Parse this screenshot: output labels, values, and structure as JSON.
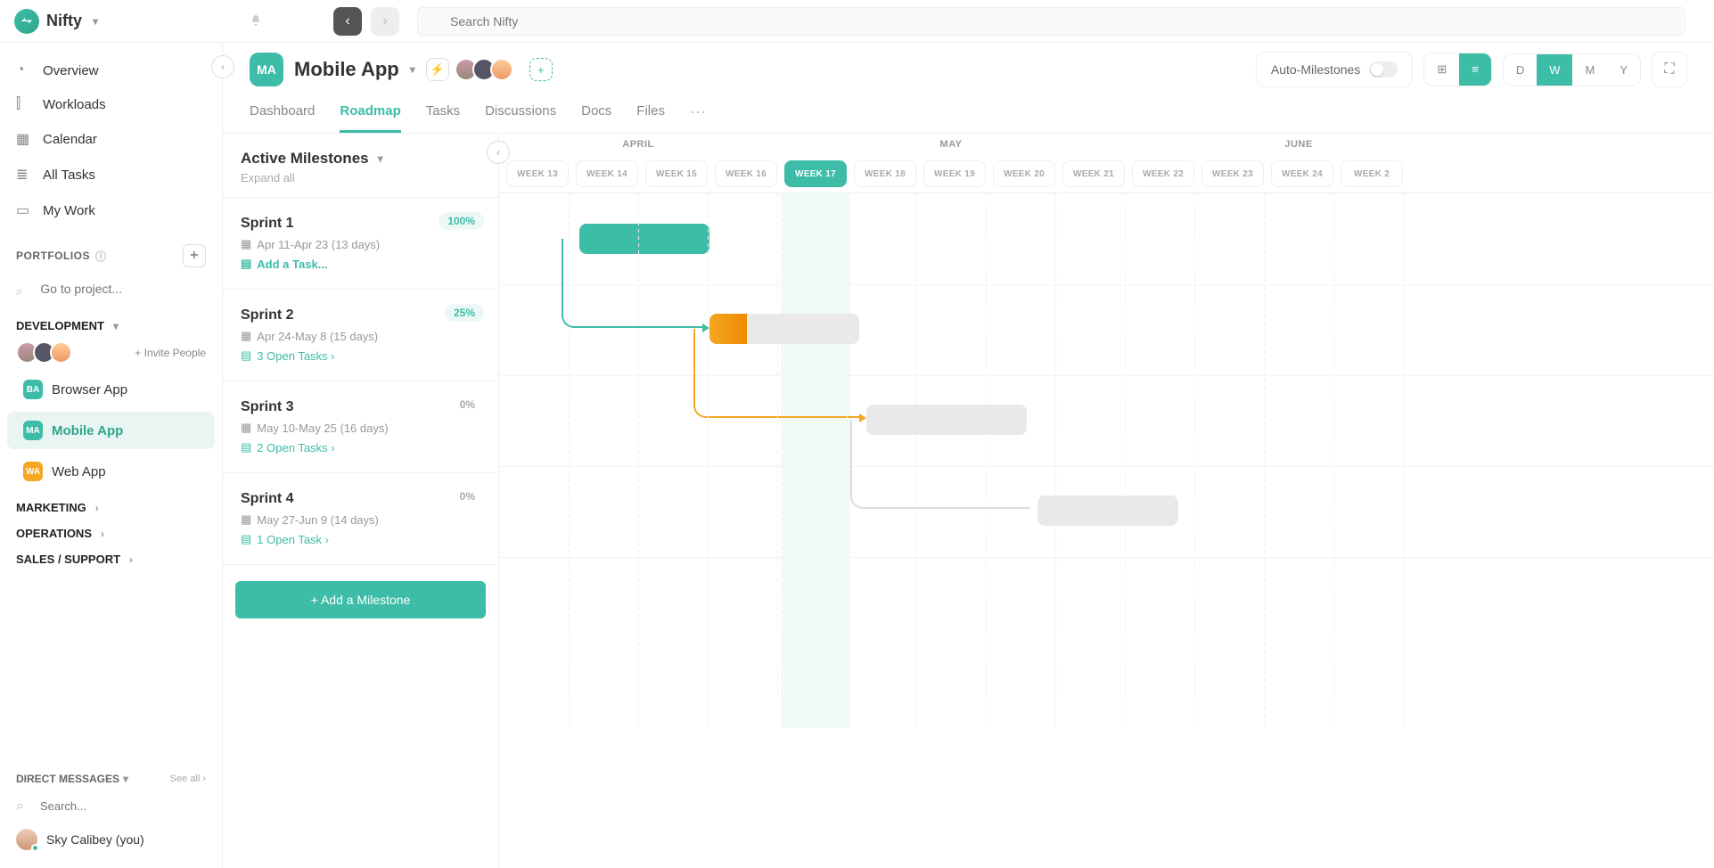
{
  "brand": "Nifty",
  "search_placeholder": "Search Nifty",
  "nav": {
    "overview": "Overview",
    "workloads": "Workloads",
    "calendar": "Calendar",
    "all_tasks": "All Tasks",
    "my_work": "My Work"
  },
  "portfolios": {
    "title": "PORTFOLIOS",
    "goto_placeholder": "Go to project...",
    "groups": {
      "development": "DEVELOPMENT",
      "marketing": "MARKETING",
      "operations": "OPERATIONS",
      "sales": "SALES / SUPPORT"
    },
    "invite": "+ Invite People",
    "projects": {
      "browser": "Browser App",
      "mobile": "Mobile App",
      "web": "Web App",
      "browser_badge": "BA",
      "mobile_badge": "MA",
      "web_badge": "WA"
    }
  },
  "dm": {
    "title": "DIRECT MESSAGES",
    "see_all": "See all",
    "search_placeholder": "Search...",
    "user1": "Sky Calibey (you)"
  },
  "project": {
    "badge": "MA",
    "title": "Mobile App",
    "auto_ms": "Auto-Milestones",
    "zoom": {
      "d": "D",
      "w": "W",
      "m": "M",
      "y": "Y"
    }
  },
  "tabs": {
    "dashboard": "Dashboard",
    "roadmap": "Roadmap",
    "tasks": "Tasks",
    "discussions": "Discussions",
    "docs": "Docs",
    "files": "Files"
  },
  "roadmap": {
    "title": "Active Milestones",
    "expand_all": "Expand all",
    "add_milestone": "+ Add a Milestone"
  },
  "milestones": [
    {
      "name": "Sprint 1",
      "dates": "Apr 11-Apr 23 (13 days)",
      "tasks": "Add a Task...",
      "pct": "100%",
      "pct_zero": false,
      "add_mode": true
    },
    {
      "name": "Sprint 2",
      "dates": "Apr 24-May 8 (15 days)",
      "tasks": "3 Open Tasks",
      "pct": "25%",
      "pct_zero": false,
      "add_mode": false
    },
    {
      "name": "Sprint 3",
      "dates": "May 10-May 25 (16 days)",
      "tasks": "2 Open Tasks",
      "pct": "0%",
      "pct_zero": true,
      "add_mode": false
    },
    {
      "name": "Sprint 4",
      "dates": "May 27-Jun 9 (14 days)",
      "tasks": "1 Open Task",
      "pct": "0%",
      "pct_zero": true,
      "add_mode": false
    }
  ],
  "timeline": {
    "months": {
      "april": "APRIL",
      "may": "MAY",
      "june": "JUNE"
    },
    "weeks": [
      "WEEK 13",
      "WEEK 14",
      "WEEK 15",
      "WEEK 16",
      "WEEK 17",
      "WEEK 18",
      "WEEK 19",
      "WEEK 20",
      "WEEK 21",
      "WEEK 22",
      "WEEK 23",
      "WEEK 24",
      "WEEK 2"
    ],
    "current_week_index": 4
  }
}
